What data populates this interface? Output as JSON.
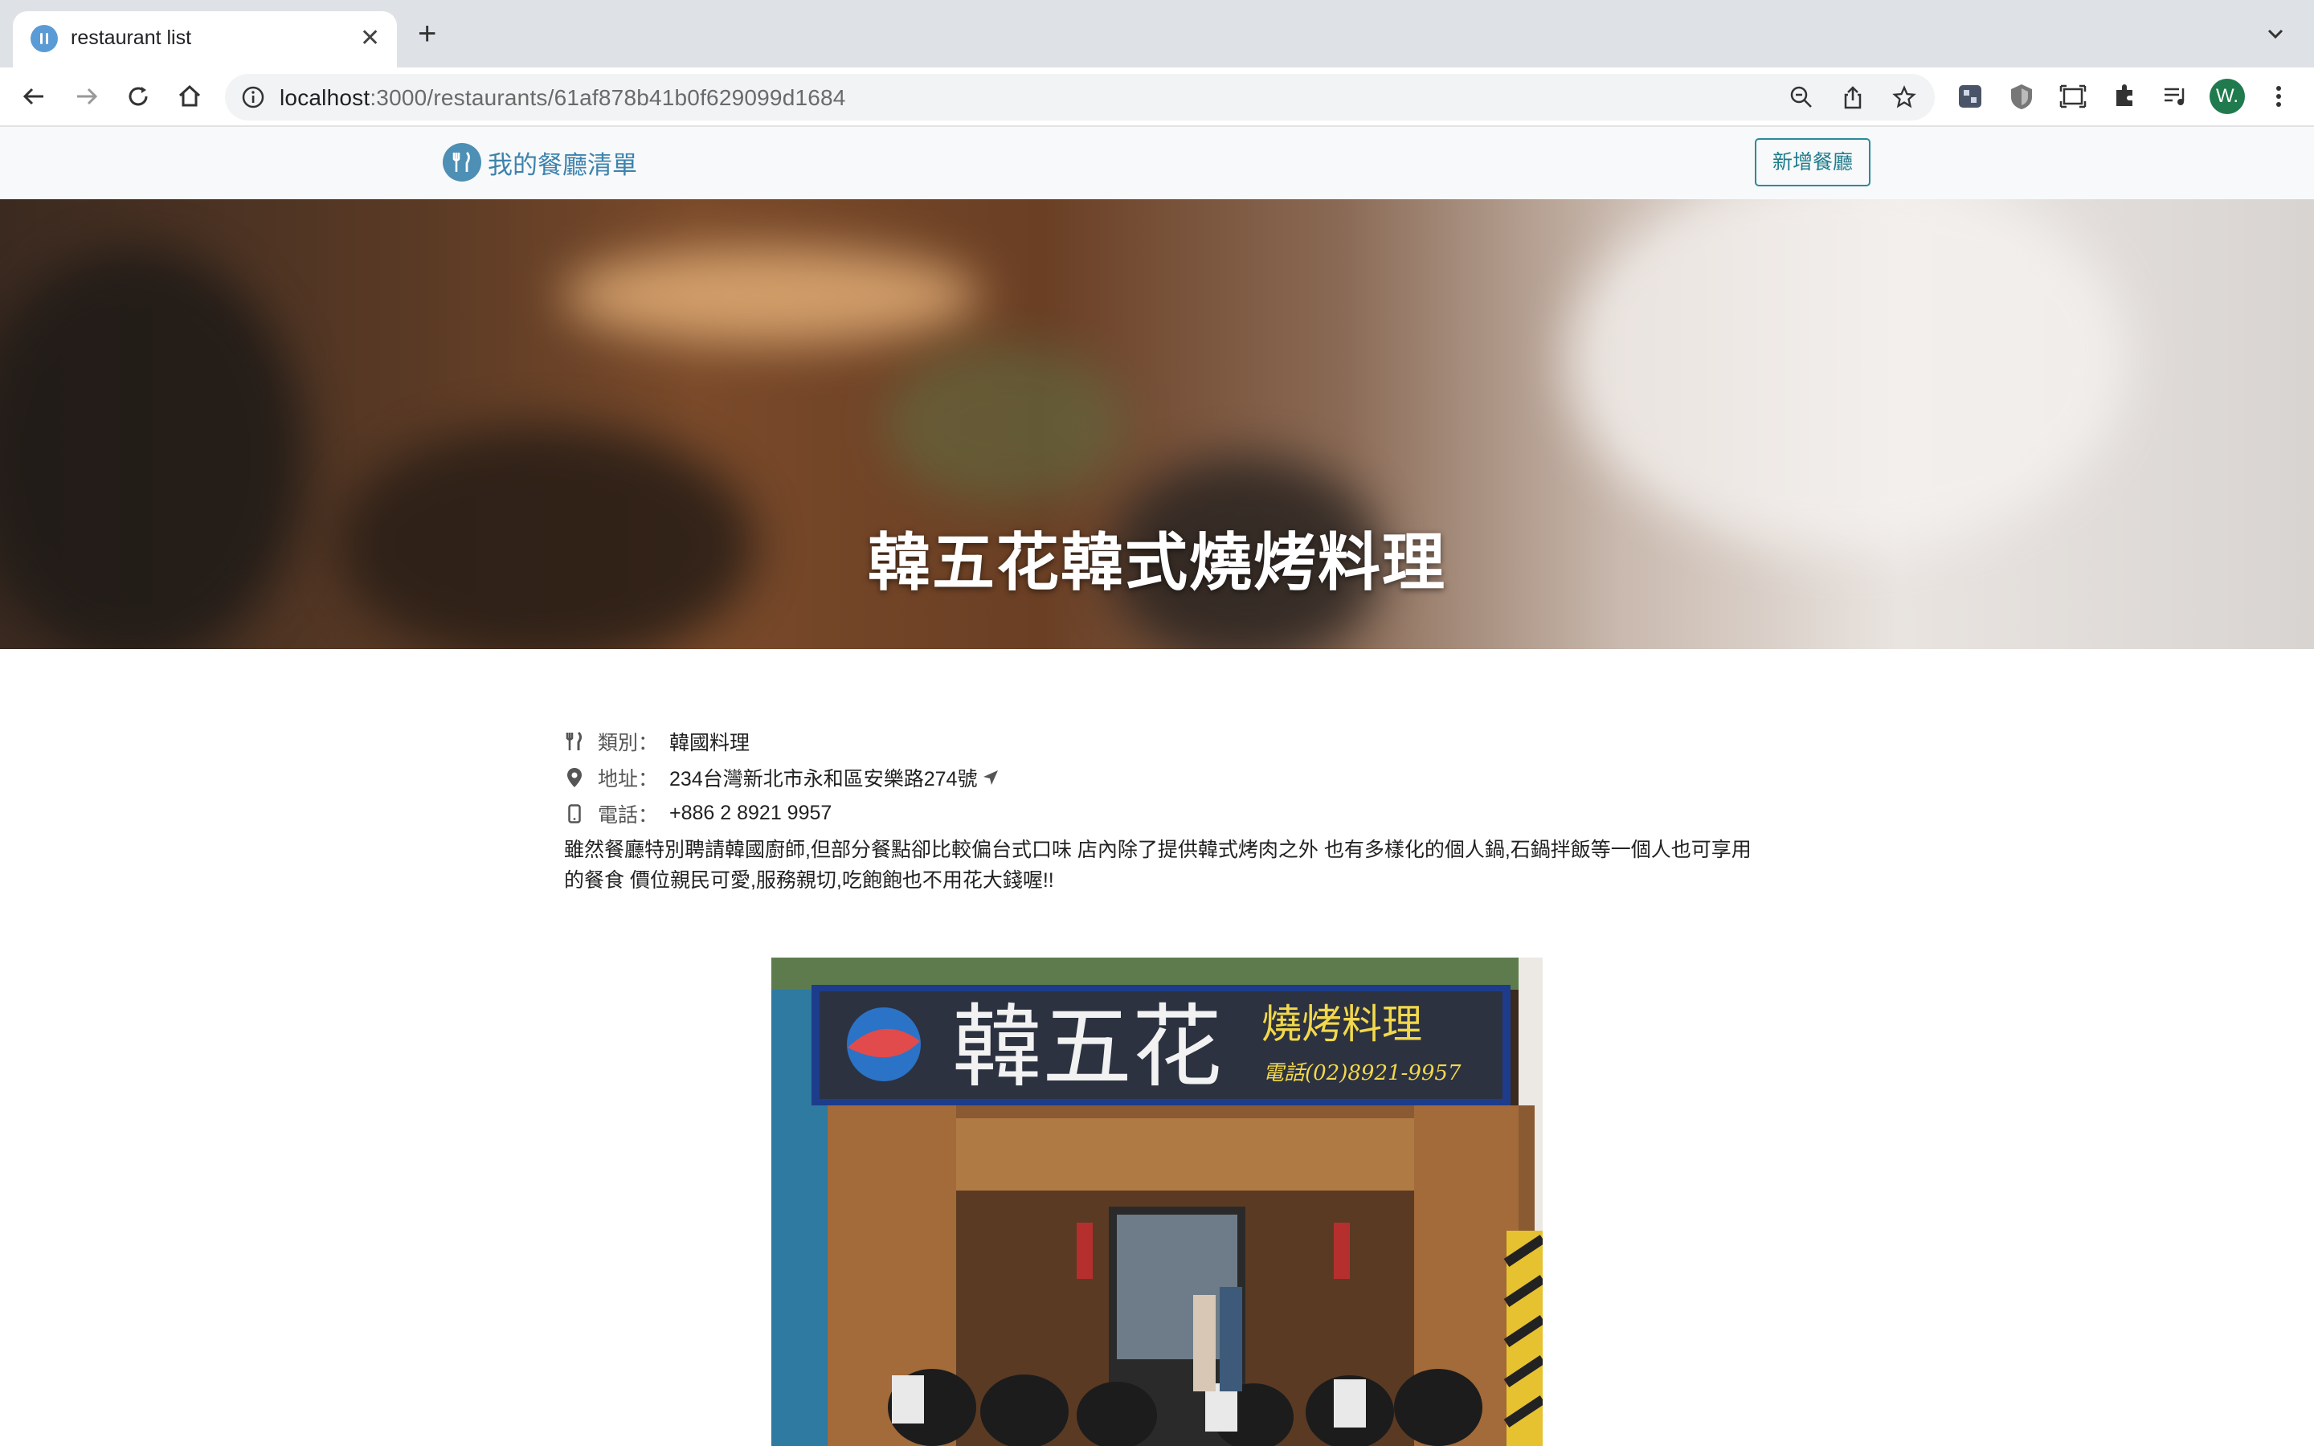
{
  "browser": {
    "tab_title": "restaurant list",
    "url_host": "localhost",
    "url_rest": ":3000/restaurants/61af878b41b0f629099d1684",
    "avatar_letter": "W.",
    "icons": [
      "back-icon",
      "forward-icon",
      "reload-icon",
      "home-icon",
      "info-icon",
      "zoom-icon",
      "share-icon",
      "star-icon",
      "extension-puzzle-icon",
      "extensions-icon",
      "media-icon",
      "screen-capture-icon",
      "menu-icon"
    ]
  },
  "navbar": {
    "brand": "我的餐廳清單",
    "add_button": "新增餐廳"
  },
  "restaurant": {
    "name": "韓五花韓式燒烤料理",
    "category_label": "類別：",
    "category": "韓國料理",
    "address_label": "地址：",
    "address": "234台灣新北市永和區安樂路274號",
    "phone_label": "電話：",
    "phone": "+886 2 8921 9957",
    "description": "雖然餐廳特別聘請韓國廚師,但部分餐點卻比較偏台式口味 店內除了提供韓式烤肉之外 也有多樣化的個人鍋,石鍋拌飯等一個人也可享用的餐食 價位親民可愛,服務親切,吃飽飽也不用花大錢喔!!"
  },
  "store_sign": {
    "main": "韓五花",
    "sub": "燒烤料理",
    "tel": "電話(02)8921-9957"
  },
  "colors": {
    "brand": "#3d83ad",
    "accent_button": "#1f7c8c",
    "navbar_bg": "#f8f9fa"
  }
}
